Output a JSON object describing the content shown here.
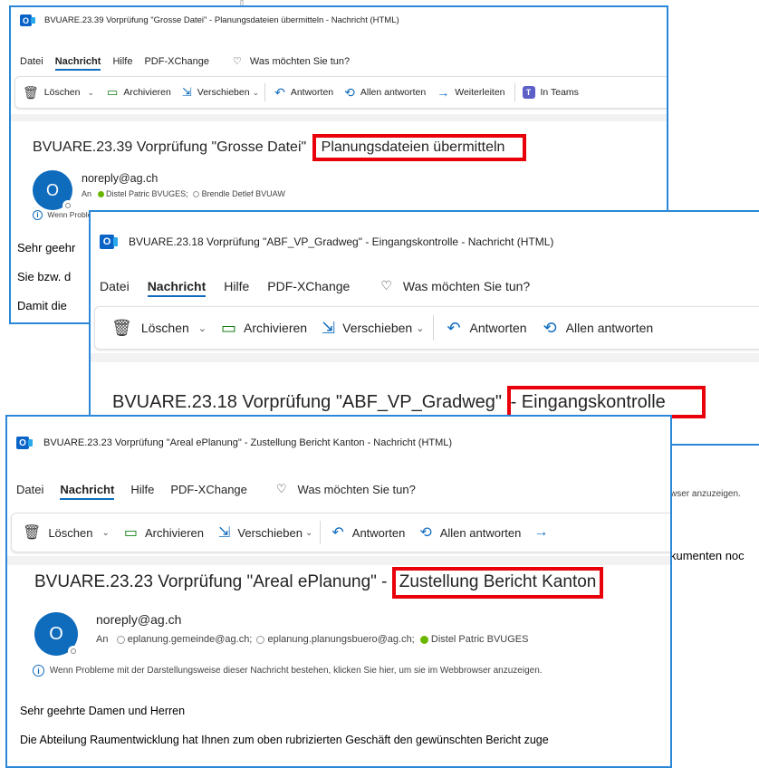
{
  "top_fragment_icon": "download-arrow-icon",
  "window1": {
    "title": "BVUARE.23.39 Vorprüfung \"Grosse Datei\" - Planungsdateien übermitteln  -  Nachricht (HTML)",
    "menu": [
      "Datei",
      "Nachricht",
      "Hilfe",
      "PDF-XChange"
    ],
    "tellme": "Was möchten Sie tun?",
    "ribbon": {
      "delete": "Löschen",
      "archive": "Archivieren",
      "move": "Verschieben",
      "reply": "Antworten",
      "reply_all": "Allen antworten",
      "forward": "Weiterleiten",
      "teams": "In Teams"
    },
    "subject_prefix": "BVUARE.23.39 Vorprüfung \"Grosse Datei\"",
    "subject_highlight": "Planungsdateien übermitteln",
    "avatar_letter": "O",
    "sender": "noreply@ag.ch",
    "to_label": "An",
    "recipients": [
      "Distel Patric  BVUGES;",
      "Brendle Detlef  BVUAW"
    ],
    "info_fragment": "Wenn Proble",
    "body": [
      "Sehr geehr",
      "Sie bzw. d",
      "Damit die"
    ]
  },
  "window2": {
    "title": "BVUARE.23.18 Vorprüfung \"ABF_VP_Gradweg\" - Eingangskontrolle  -  Nachricht (HTML)",
    "menu": [
      "Datei",
      "Nachricht",
      "Hilfe",
      "PDF-XChange"
    ],
    "tellme": "Was möchten Sie tun?",
    "ribbon": {
      "delete": "Löschen",
      "archive": "Archivieren",
      "move": "Verschieben",
      "reply": "Antworten",
      "reply_all": "Allen antworten"
    },
    "subject_prefix": "BVUARE.23.18 Vorprüfung \"ABF_VP_Gradweg\"",
    "subject_highlight": "- Eingangskontrolle",
    "fragment_browser": "wser anzuzeigen.",
    "fragment_docs": "kumenten noc"
  },
  "window3": {
    "title": "BVUARE.23.23 Vorprüfung \"Areal ePlanung\" - Zustellung Bericht Kanton  -  Nachricht (HTML)",
    "menu": [
      "Datei",
      "Nachricht",
      "Hilfe",
      "PDF-XChange"
    ],
    "tellme": "Was möchten Sie tun?",
    "ribbon": {
      "delete": "Löschen",
      "archive": "Archivieren",
      "move": "Verschieben",
      "reply": "Antworten",
      "reply_all": "Allen antworten"
    },
    "subject_prefix": "BVUARE.23.23 Vorprüfung \"Areal ePlanung\" -",
    "subject_highlight": "Zustellung Bericht Kanton",
    "avatar_letter": "O",
    "sender": "noreply@ag.ch",
    "to_label": "An",
    "recipients": [
      "eplanung.gemeinde@ag.ch;",
      "eplanung.planungsbuero@ag.ch;",
      "Distel Patric  BVUGES"
    ],
    "info": "Wenn Probleme mit der Darstellungsweise dieser Nachricht bestehen, klicken Sie hier, um sie im Webbrowser anzuzeigen.",
    "greeting": "Sehr geehrte Damen und Herren",
    "body1": "Die Abteilung Raumentwicklung hat Ihnen zum oben rubrizierten Geschäft den gewünschten Bericht zuge"
  },
  "colors": {
    "highlight_box": "#e8000b",
    "window_border": "#2b88d8",
    "outlook_blue": "#0a64c8",
    "avatar_blue": "#0f6cbd",
    "presence_green": "#6bb700"
  }
}
